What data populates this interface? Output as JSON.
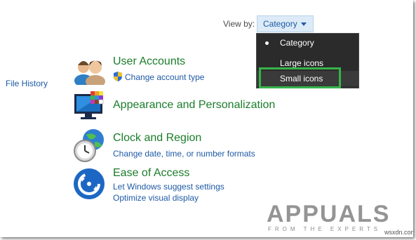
{
  "header": {
    "view_by_label": "View by:",
    "view_by_value": "Category"
  },
  "view_menu": {
    "items": [
      {
        "label": "Category",
        "selected": true
      },
      {
        "label": "Large icons",
        "selected": false
      },
      {
        "label": "Small icons",
        "selected": false,
        "highlighted": true
      }
    ]
  },
  "sidebar": {
    "file_history": "File History"
  },
  "categories": [
    {
      "title": "User Accounts",
      "links": [
        "Change account type"
      ],
      "icon": "users-icon"
    },
    {
      "title": "Appearance and Personalization",
      "links": [],
      "icon": "monitor-palette-icon"
    },
    {
      "title": "Clock and Region",
      "links": [
        "Change date, time, or number formats"
      ],
      "icon": "clock-globe-icon"
    },
    {
      "title": "Ease of Access",
      "links": [
        "Let Windows suggest settings",
        "Optimize visual display"
      ],
      "icon": "ease-of-access-icon"
    }
  ],
  "watermark": {
    "brand": "APPUALS",
    "tagline": "FROM THE EXPERTS",
    "site": "wsxdn.com"
  },
  "colors": {
    "link": "#1e5aa6",
    "category_title": "#1b7d2a",
    "menu_bg": "#2b2b2b",
    "highlight_box": "#36b34a"
  }
}
